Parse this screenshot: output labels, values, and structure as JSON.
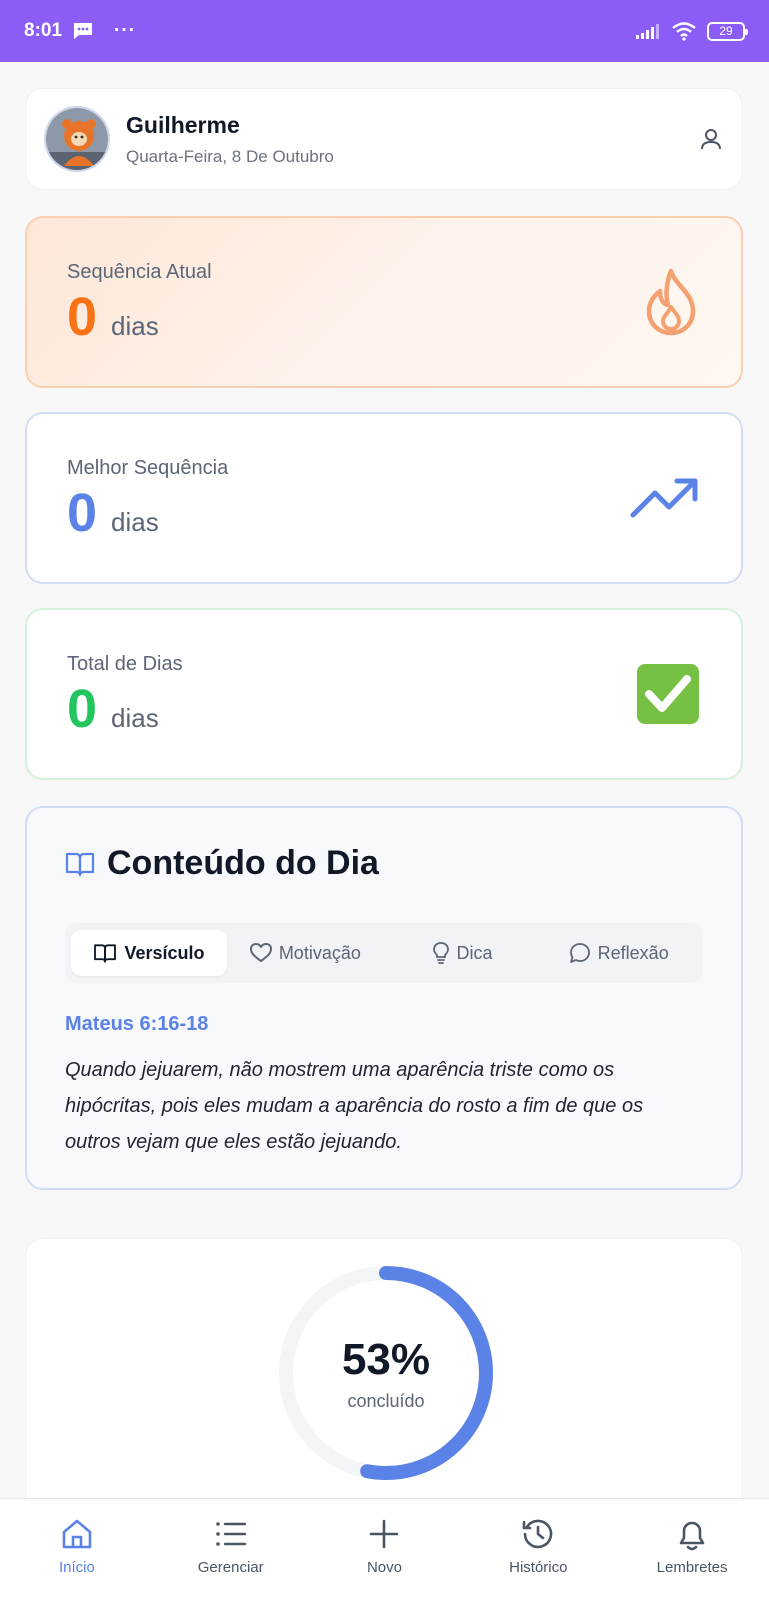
{
  "status_bar": {
    "time": "8:01",
    "dots": "···",
    "battery": "29"
  },
  "profile": {
    "name": "Guilherme",
    "date": "Quarta-Feira, 8 De Outubro"
  },
  "stats": {
    "current": {
      "label": "Sequência Atual",
      "value": "0",
      "unit": "dias",
      "color": "#f97316",
      "icon": "flame-icon"
    },
    "best": {
      "label": "Melhor Sequência",
      "value": "0",
      "unit": "dias",
      "color": "#5b82e6",
      "icon": "trending-up-icon"
    },
    "total": {
      "label": "Total de Dias",
      "value": "0",
      "unit": "dias",
      "color": "#22c55e",
      "icon": "check-mark-icon"
    }
  },
  "content": {
    "title": "Conteúdo do Dia",
    "tabs": [
      {
        "label": "Versículo",
        "icon": "book-icon",
        "active": true
      },
      {
        "label": "Motivação",
        "icon": "heart-icon",
        "active": false
      },
      {
        "label": "Dica",
        "icon": "lightbulb-icon",
        "active": false
      },
      {
        "label": "Reflexão",
        "icon": "chat-bubble-icon",
        "active": false
      }
    ],
    "verse_ref": "Mateus 6:16-18",
    "verse_text": "Quando jejuarem, não mostrem uma aparência triste como os hipócritas, pois eles mudam a aparência do rosto a fim de que os outros vejam que eles estão jejuando."
  },
  "progress": {
    "value_label": "53%",
    "fraction": 0.53,
    "caption": "concluído",
    "color": "#5b82e6"
  },
  "nav": [
    {
      "label": "Início",
      "icon": "home-icon",
      "active": true
    },
    {
      "label": "Gerenciar",
      "icon": "list-icon",
      "active": false
    },
    {
      "label": "Novo",
      "icon": "plus-icon",
      "active": false
    },
    {
      "label": "Histórico",
      "icon": "history-icon",
      "active": false
    },
    {
      "label": "Lembretes",
      "icon": "bell-icon",
      "active": false
    }
  ]
}
